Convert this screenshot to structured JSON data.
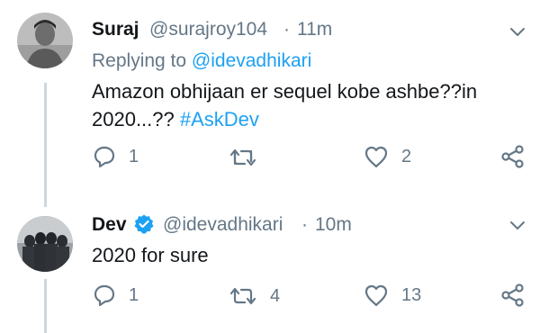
{
  "tweets": [
    {
      "name": "Suraj",
      "handle": "@surajroy104",
      "separator": "·",
      "time": "11m",
      "replying_prefix": "Replying to",
      "replying_handle": "@idevadhikari",
      "text": "Amazon obhijaan er sequel kobe ashbe??in",
      "text_line2_plain": "2020...??",
      "hashtag": "#AskDev",
      "reply_count": "1",
      "retweet_count": "",
      "like_count": "2",
      "verified": false
    },
    {
      "name": "Dev",
      "handle": "@idevadhikari",
      "separator": "·",
      "time": "10m",
      "text": "2020 for sure",
      "reply_count": "1",
      "retweet_count": "4",
      "like_count": "13",
      "verified": true
    }
  ],
  "colors": {
    "accent": "#1da1f2",
    "secondary_text": "#657786",
    "primary_text": "#14171a",
    "thread_line": "#ccd6dd"
  },
  "icons": [
    "reply-icon",
    "retweet-icon",
    "like-icon",
    "share-icon",
    "chevron-down-icon",
    "verified-badge-icon"
  ]
}
